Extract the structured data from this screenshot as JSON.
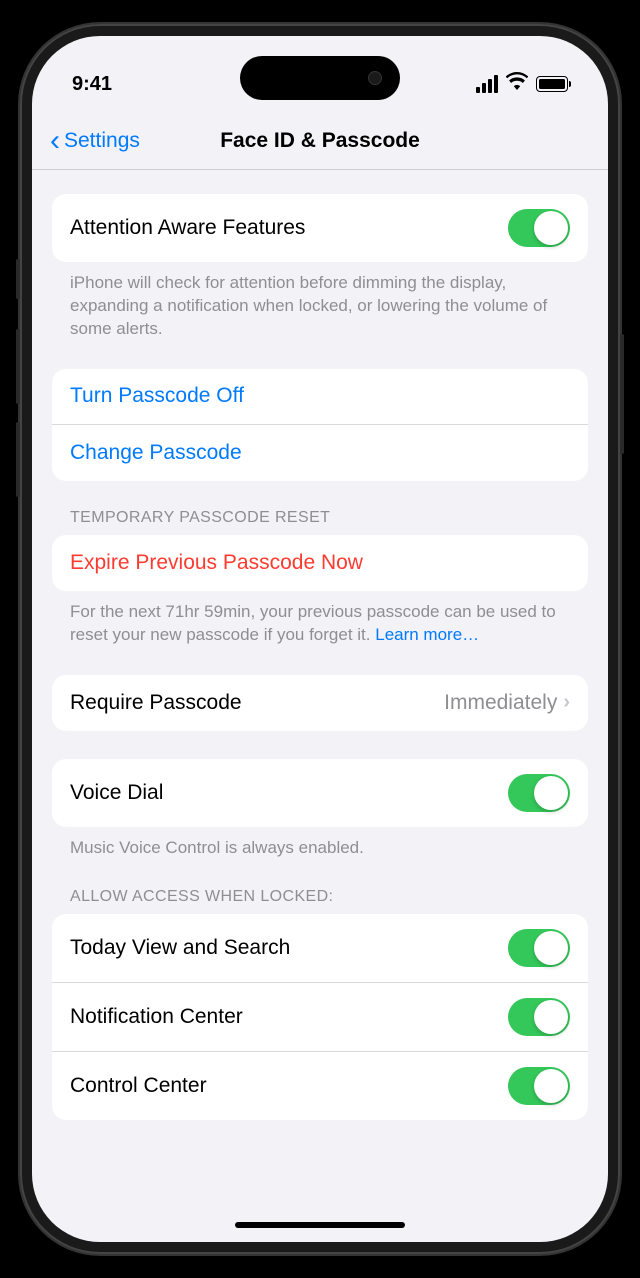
{
  "status": {
    "time": "9:41"
  },
  "nav": {
    "back_label": "Settings",
    "title": "Face ID & Passcode"
  },
  "attention": {
    "label": "Attention Aware Features",
    "footer": "iPhone will check for attention before dimming the display, expanding a notification when locked, or lowering the volume of some alerts."
  },
  "passcode": {
    "turn_off": "Turn Passcode Off",
    "change": "Change Passcode"
  },
  "temp_reset": {
    "header": "TEMPORARY PASSCODE RESET",
    "expire": "Expire Previous Passcode Now",
    "footer": "For the next 71hr 59min, your previous passcode can be used to reset your new passcode if you forget it.",
    "learn_more": "Learn more…"
  },
  "require": {
    "label": "Require Passcode",
    "value": "Immediately"
  },
  "voice_dial": {
    "label": "Voice Dial",
    "footer": "Music Voice Control is always enabled."
  },
  "allow_access": {
    "header": "ALLOW ACCESS WHEN LOCKED:",
    "items": [
      "Today View and Search",
      "Notification Center",
      "Control Center"
    ]
  }
}
